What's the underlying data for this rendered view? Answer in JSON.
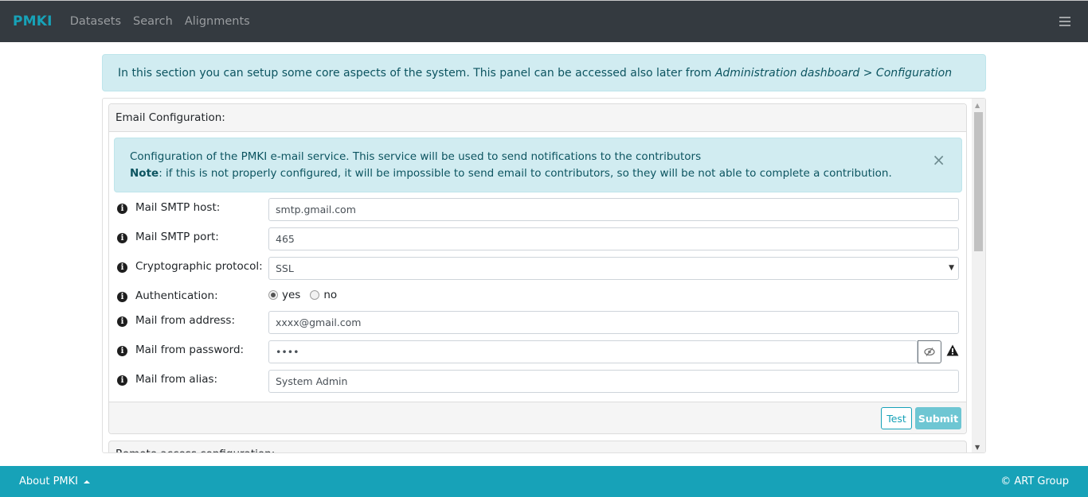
{
  "navbar": {
    "brand": "PMKI",
    "links": [
      "Datasets",
      "Search",
      "Alignments"
    ],
    "menu_icon": "hamburger-icon"
  },
  "info_alert": {
    "text": "In this section you can setup some core aspects of the system. This panel can be accessed also later from ",
    "path_italic": "Administration dashboard > Configuration"
  },
  "email_config": {
    "header": "Email Configuration:",
    "alert": {
      "line1": "Configuration of the PMKI e-mail service. This service will be used to send notifications to the contributors",
      "note_label": "Note",
      "line2": ": if this is not properly configured, it will be impossible to send email to contributors, so they will be not able to complete a contribution.",
      "close": "×"
    },
    "fields": {
      "smtp_host": {
        "label": "Mail SMTP host:",
        "value": "smtp.gmail.com"
      },
      "smtp_port": {
        "label": "Mail SMTP port:",
        "value": "465"
      },
      "protocol": {
        "label": "Cryptographic protocol:",
        "value": "SSL"
      },
      "auth": {
        "label": "Authentication:",
        "options": [
          "yes",
          "no"
        ],
        "selected": "yes"
      },
      "from_address": {
        "label": "Mail from address:",
        "value": "xxxx@gmail.com"
      },
      "from_password": {
        "label": "Mail from password:",
        "value": "••••"
      },
      "from_alias": {
        "label": "Mail from alias:",
        "value": "System Admin"
      }
    },
    "buttons": {
      "test": "Test",
      "submit": "Submit"
    }
  },
  "remote_access": {
    "header": "Remote access configuration:"
  },
  "footer": {
    "about": "About PMKI",
    "copyright": "© ART Group"
  },
  "colors": {
    "navbar_bg": "#343a40",
    "accent": "#17a2b8",
    "alert_bg": "#d1ecf1",
    "alert_text": "#0c5460"
  }
}
